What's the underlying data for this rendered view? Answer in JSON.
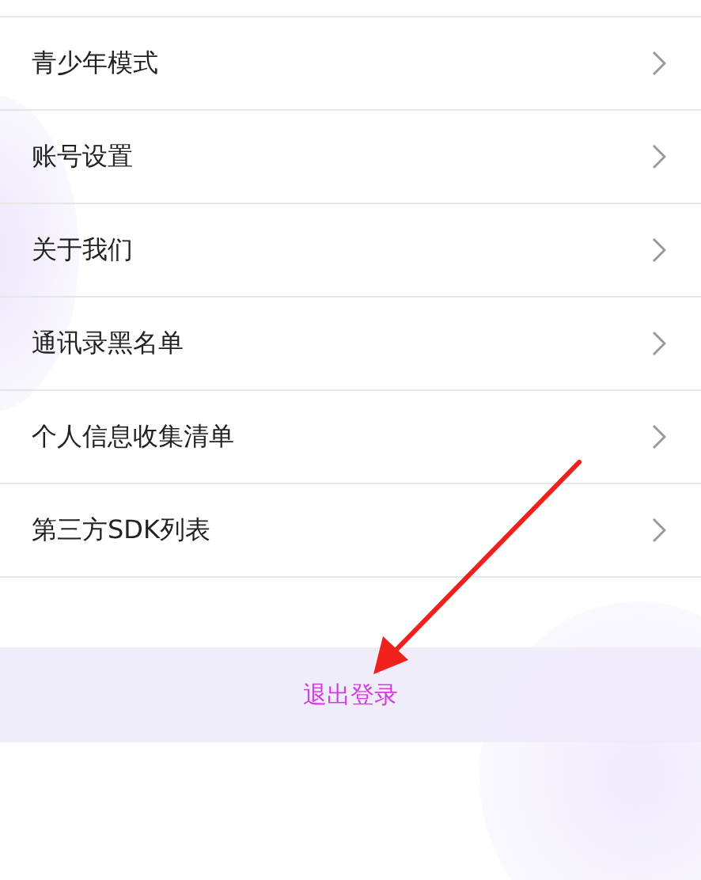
{
  "menu_items": [
    {
      "label": "青少年模式"
    },
    {
      "label": "账号设置"
    },
    {
      "label": "关于我们"
    },
    {
      "label": "通讯录黑名单"
    },
    {
      "label": "个人信息收集清单"
    },
    {
      "label": "第三方SDK列表"
    }
  ],
  "logout_button": {
    "label": "退出登录"
  }
}
